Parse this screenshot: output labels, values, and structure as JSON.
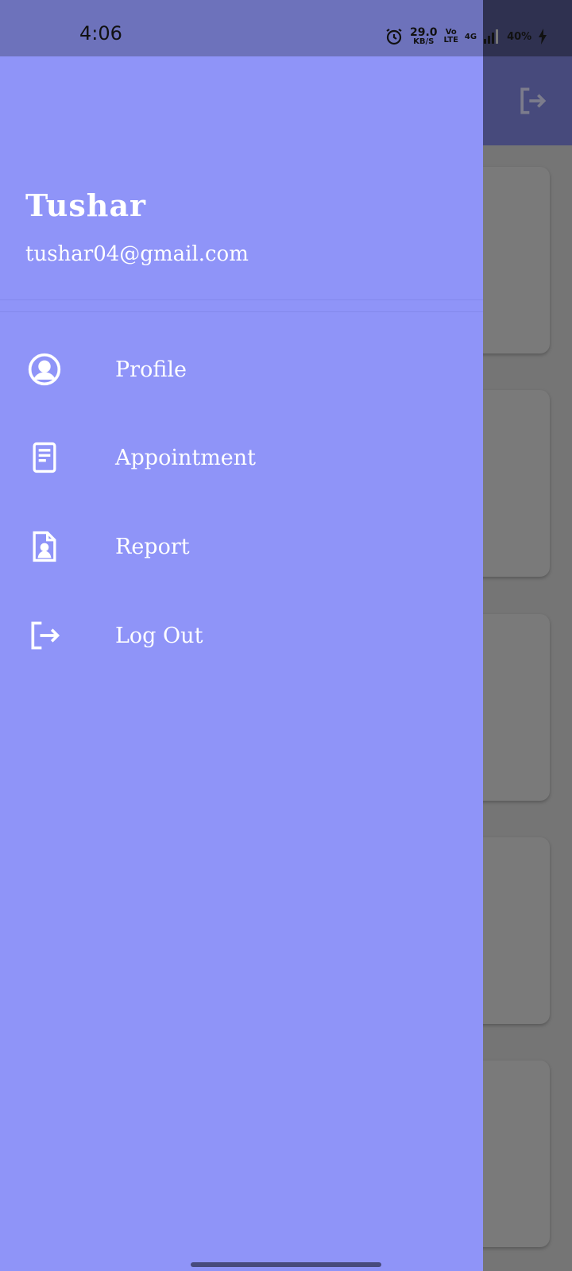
{
  "status_bar": {
    "time": "4:06",
    "speed_value": "29.0",
    "speed_unit": "KB/S",
    "volte_top": "Vo",
    "volte_bottom": "LTE",
    "network": "4G",
    "battery": "40%",
    "icons": [
      "alarm-icon",
      "signal-icon",
      "battery-charging-icon"
    ]
  },
  "drawer": {
    "user_name": "Tushar",
    "user_email": "tushar04@gmail.com",
    "items": [
      {
        "label": "Profile",
        "icon": "account-circle-icon"
      },
      {
        "label": "Appointment",
        "icon": "document-icon"
      },
      {
        "label": "Report",
        "icon": "report-file-icon"
      },
      {
        "label": "Log Out",
        "icon": "logout-icon"
      }
    ]
  },
  "background": {
    "appbar_action_icon": "logout-icon",
    "card_count": 5
  },
  "colors": {
    "drawer": "#8f94f8",
    "status_drawer": "#6d72bb",
    "appbar_dimmed": "#474a7c",
    "scrim_background": "#757575",
    "text": "#ffffff"
  }
}
